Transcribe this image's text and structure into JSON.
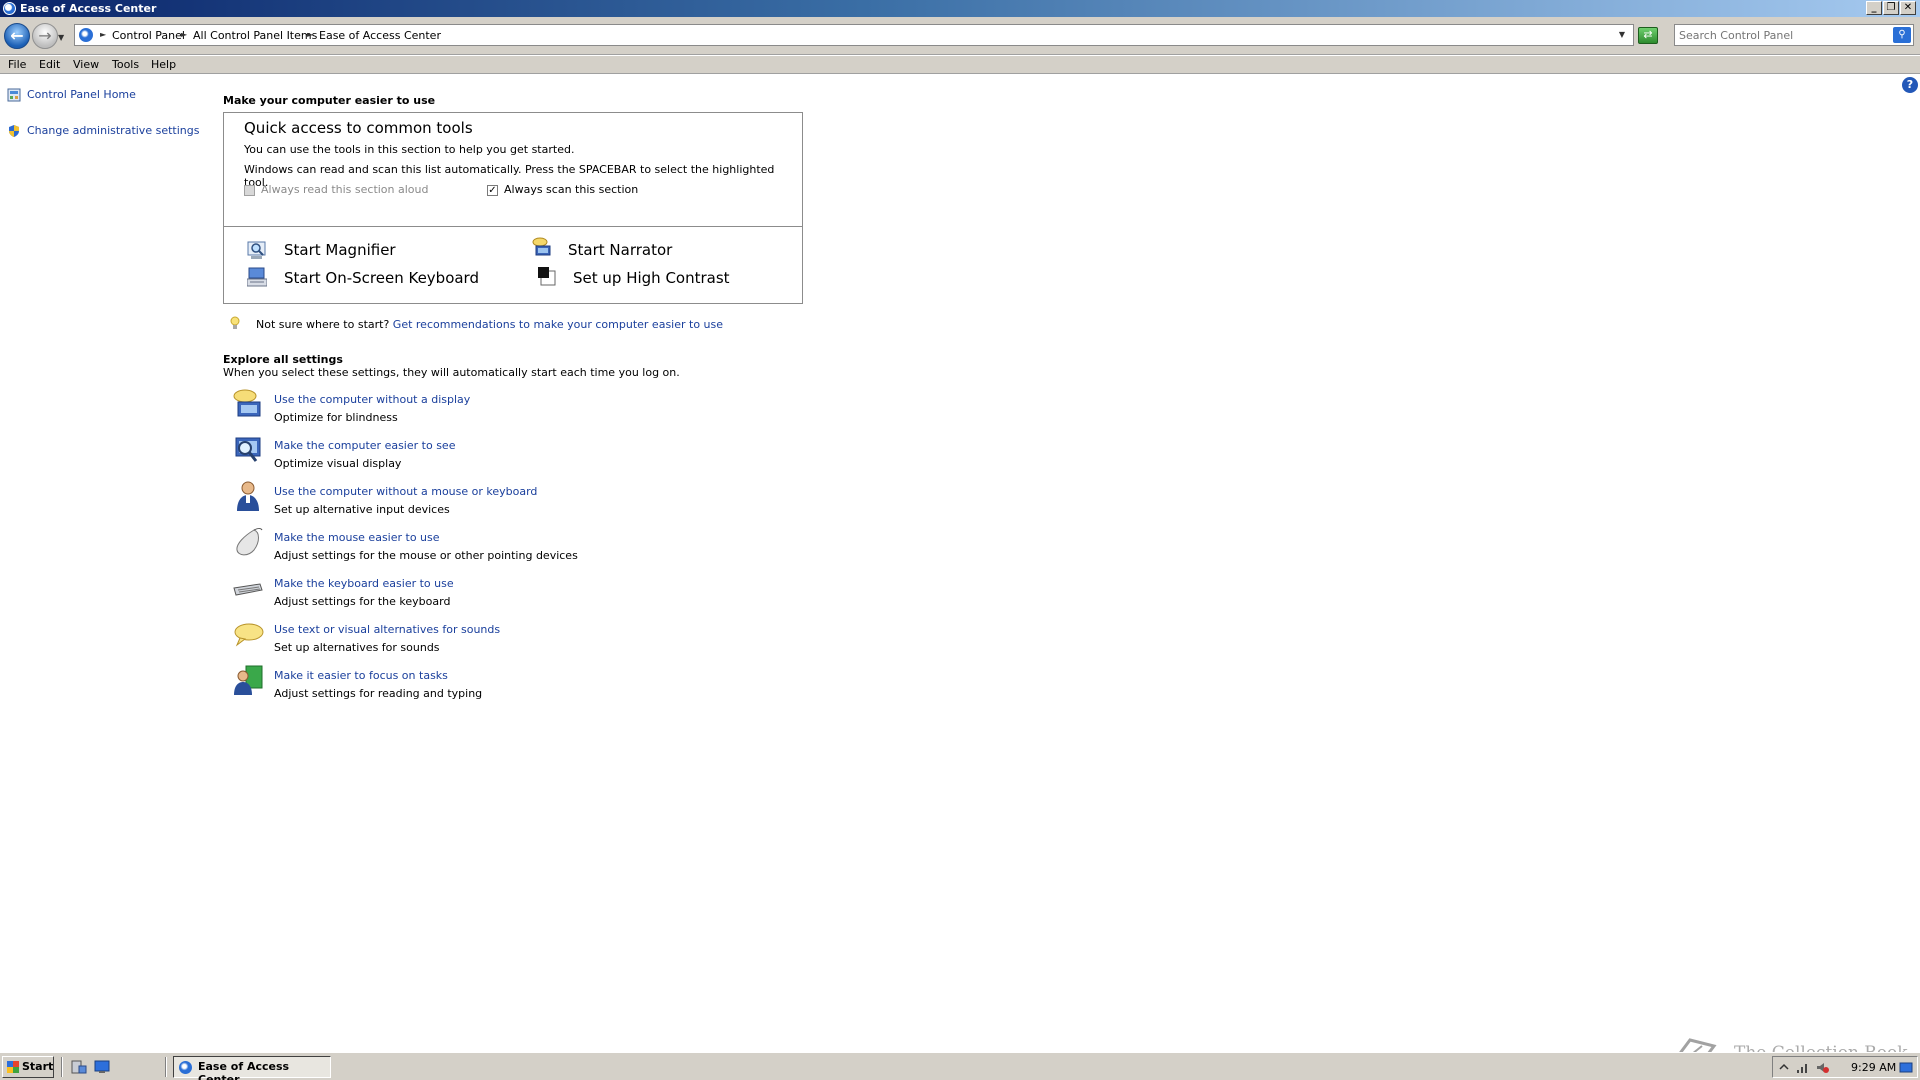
{
  "window": {
    "title": "Ease of Access Center",
    "controls": [
      "_",
      "❐",
      "✕"
    ]
  },
  "address_bar": {
    "breadcrumbs": [
      "Control Panel",
      "All Control Panel Items",
      "Ease of Access Center"
    ],
    "search_placeholder": "Search Control Panel"
  },
  "menu": {
    "items": [
      "File",
      "Edit",
      "View",
      "Tools",
      "Help"
    ]
  },
  "sidebar": {
    "links": [
      {
        "label": "Control Panel Home",
        "icon": "control-panel-icon"
      },
      {
        "label": "Change administrative settings",
        "icon": "admin-shield-icon"
      }
    ]
  },
  "main": {
    "heading": "Make your computer easier to use",
    "quick_access": {
      "title": "Quick access to common tools",
      "line1": "You can use the tools in this section to help you get started.",
      "line2": "Windows can read and scan this list automatically.  Press the SPACEBAR to select the highlighted tool.",
      "read_aloud": {
        "label": "Always read this section aloud",
        "checked": false,
        "disabled": true
      },
      "scan": {
        "label": "Always scan this section",
        "checked": true
      },
      "tools": [
        {
          "label": "Start Magnifier",
          "icon": "magnifier-icon"
        },
        {
          "label": "Start Narrator",
          "icon": "narrator-icon"
        },
        {
          "label": "Start On-Screen Keyboard",
          "icon": "on-screen-keyboard-icon"
        },
        {
          "label": "Set up High Contrast",
          "icon": "high-contrast-icon"
        }
      ]
    },
    "tip": {
      "prefix": "Not sure where to start?",
      "link": "Get recommendations to make your computer easier to use"
    },
    "explore": {
      "title": "Explore all settings",
      "subtitle": "When you select these settings, they will automatically start each time you log on.",
      "items": [
        {
          "link": "Use the computer without a display",
          "desc": "Optimize for blindness",
          "icon": "speech-monitor-icon"
        },
        {
          "link": "Make the computer easier to see",
          "desc": "Optimize visual display",
          "icon": "magnify-monitor-icon"
        },
        {
          "link": "Use the computer without a mouse or keyboard",
          "desc": "Set up alternative input devices",
          "icon": "person-icon"
        },
        {
          "link": "Make the mouse easier to use",
          "desc": "Adjust settings for the mouse or other pointing devices",
          "icon": "mouse-icon"
        },
        {
          "link": "Make the keyboard easier to use",
          "desc": "Adjust settings for the keyboard",
          "icon": "keyboard-icon"
        },
        {
          "link": "Use text or visual alternatives for sounds",
          "desc": "Set up alternatives for sounds",
          "icon": "speech-bubble-icon"
        },
        {
          "link": "Make it easier to focus on tasks",
          "desc": "Adjust settings for reading and typing",
          "icon": "focus-user-icon"
        }
      ]
    }
  },
  "taskbar": {
    "start_label": "Start",
    "task_label": "Ease of Access Center",
    "clock": "9:29 AM"
  },
  "watermark": {
    "text": "The Collection Book"
  },
  "colors": {
    "link": "#1a3f9c",
    "chrome": "#d4d0c8",
    "titlebar": "#0a246a"
  }
}
